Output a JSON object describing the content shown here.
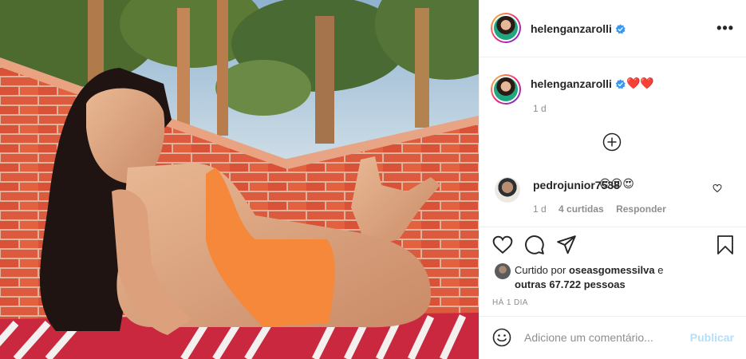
{
  "post": {
    "image_alt": "helenganzarolli photo",
    "author": "helenganzarolli",
    "more_label": "•••"
  },
  "caption": {
    "username": "helenganzarolli",
    "text": "❤️❤️",
    "time": "1 d"
  },
  "comment": {
    "username": "pedrojunior7538",
    "text": "😍😍😍",
    "time": "1 d",
    "likes": "4 curtidas",
    "reply": "Responder"
  },
  "likes": {
    "prefix": "Curtido por",
    "user": "oseasgomessilva",
    "conj": "e",
    "others": "outras 67.722 pessoas"
  },
  "date": "HÁ 1 DIA",
  "add_comment": {
    "placeholder": "Adicione um comentário...",
    "publish_label": "Publicar"
  },
  "colors": {
    "verified": "#3897f0",
    "publish_disabled": "#b2dffc",
    "secondary_text": "#8e8e8e",
    "swimsuit": "#f5883a",
    "brick": "#d9553a"
  },
  "icons": [
    "verified-icon",
    "more-icon",
    "add-icon",
    "heart-icon",
    "comment-icon",
    "share-icon",
    "save-icon",
    "smiley-icon"
  ]
}
